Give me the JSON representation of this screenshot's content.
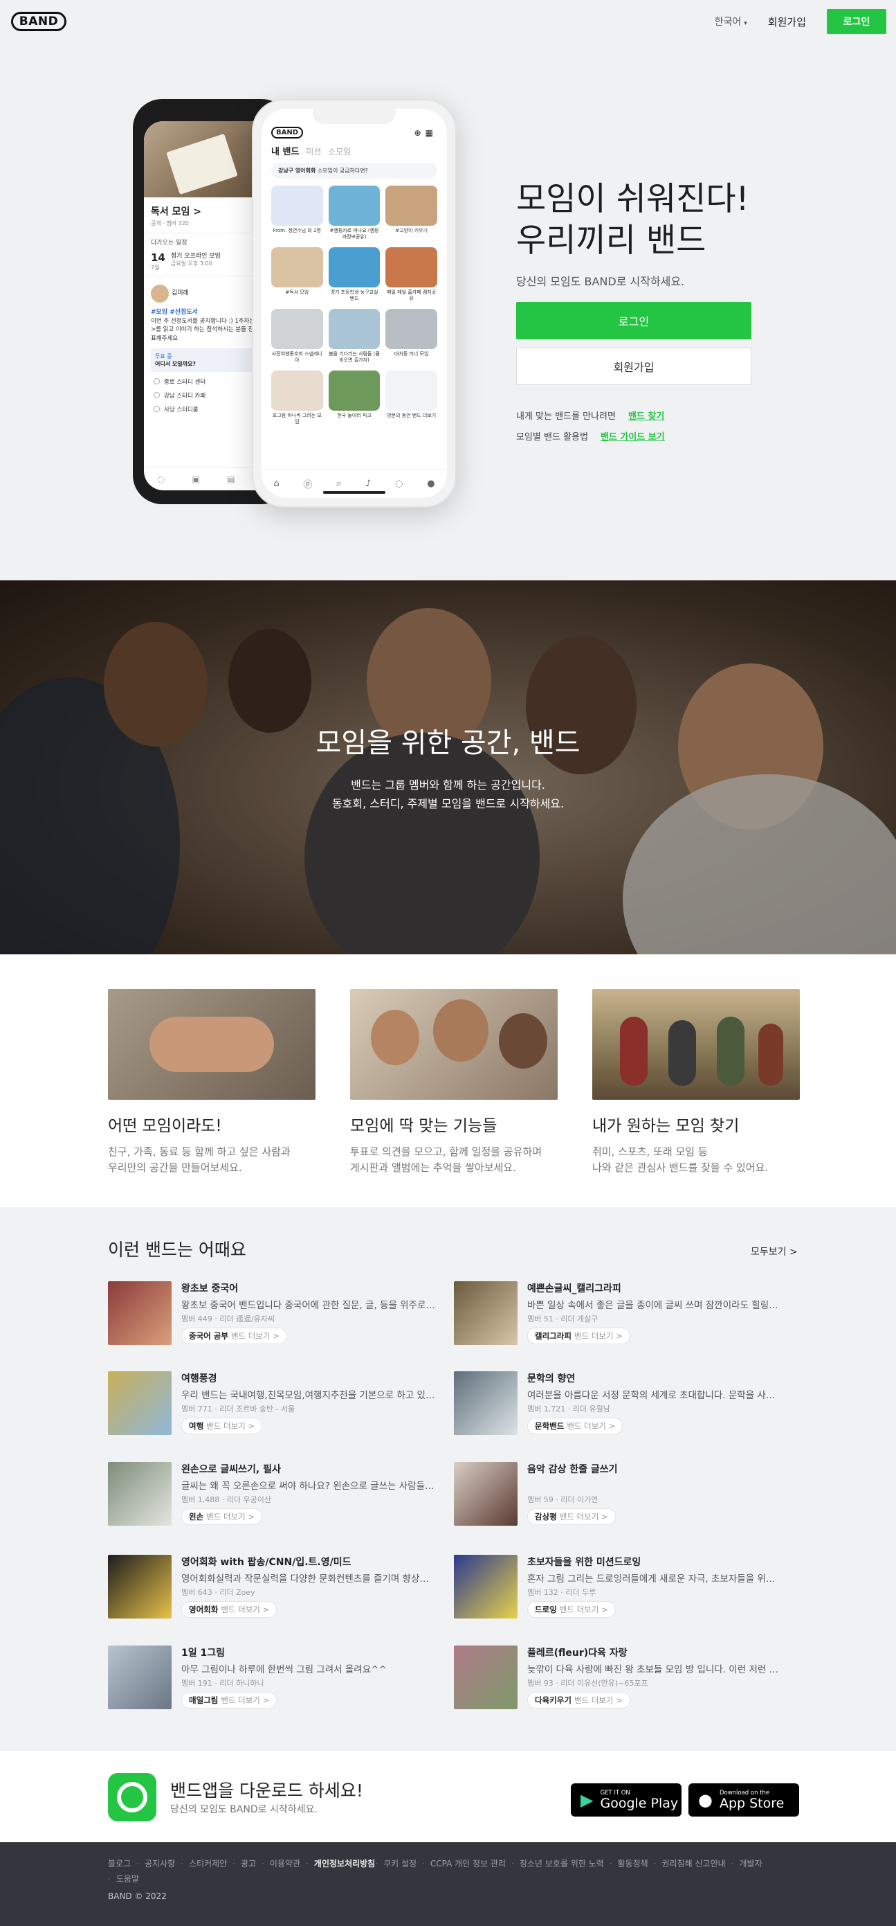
{
  "header": {
    "logo": "BAND",
    "language": "한국어",
    "signup": "회원가입",
    "login": "로그인"
  },
  "hero": {
    "title_line1": "모임이 쉬워진다!",
    "title_line2": "우리끼리 밴드",
    "subtitle": "당신의 모임도 BAND로 시작하세요.",
    "login_button": "로그인",
    "signup_button": "회원가입",
    "link1_text": "내게 맞는 밴드를 만나려면",
    "link1_label": "밴드 찾기",
    "link2_text": "모임별 밴드 활용법",
    "link2_label": "밴드 가이드 보기"
  },
  "phone_back": {
    "band_title": "독서 모임 >",
    "band_meta": "공개 · 멤버 320",
    "upcoming": "다가오는 일정",
    "date_day": "14",
    "date_month": "7월",
    "event_title": "정기 오프라인 모임",
    "event_time": "금요일 오후 3:00",
    "author": "김미래",
    "hashtags": "#모임 #선정도서",
    "post_text": "이번 주 선정도서를 공지합니다 :) 1주차는 <고래>를 읽고 이야기 하는 참석하시는 분들 장소를 투표해주세요",
    "vote_label": "투표 중",
    "vote_question": "어디서 모일까요?",
    "options": [
      "종로 스터디 센터",
      "강남 스터디 카페",
      "사당 스터디룸"
    ]
  },
  "phone_front": {
    "logo": "BAND",
    "tab_mine": "내 밴드",
    "tab_mission": "미션",
    "tab_small": "소모임",
    "notice_bold": "강남구 영어회화",
    "notice_text": "소모임이 궁금하다면?",
    "grid": [
      {
        "label": "From. 정연수님 외 2명",
        "color": "#dfe6f6"
      },
      {
        "label": "#캠핑카로 떠나요 (캠핑카정보공유)",
        "color": "#6fb3d9"
      },
      {
        "label": "#고양이 키우기",
        "color": "#c8a37e"
      },
      {
        "label": "#독서 모임",
        "color": "#d9c3a2"
      },
      {
        "label": "경기 초등학생 농구교실 밴드",
        "color": "#4a9fd1"
      },
      {
        "label": "매일 매일 홈카페 캠지공유",
        "color": "#c9784b"
      },
      {
        "label": "사진여행동호회 스냅레니아",
        "color": "#cfd3d6"
      },
      {
        "label": "봄을 기다리는 사람들 (물비오면 출가자)",
        "color": "#a9c4d4"
      },
      {
        "label": "대치동 러너 모임",
        "color": "#b9bec4"
      },
      {
        "label": "포그림 하나씩 그려는 모임",
        "color": "#e7dccd"
      },
      {
        "label": "한국 놀이터 피크",
        "color": "#6d9a5a"
      },
      {
        "label": "방문의 동안 밴드 더보기",
        "color": "#f2f3f5"
      }
    ]
  },
  "banner": {
    "title": "모임을 위한 공간, 밴드",
    "line1": "밴드는 그룹 멤버와 함께 하는 공간입니다.",
    "line2": "동호회, 스터디, 주제별 모임을 밴드로 시작하세요."
  },
  "features": [
    {
      "title": "어떤 모임이라도!",
      "line1": "친구, 가족, 동료 등 함께 하고 싶은 사람과",
      "line2": "우리만의 공간을 만들어보세요."
    },
    {
      "title": "모임에 딱 맞는 기능들",
      "line1": "투표로 의견을 모으고, 함께 일정을 공유하며",
      "line2": "게시판과 앨범에는 추억을 쌓아보세요."
    },
    {
      "title": "내가 원하는 모임 찾기",
      "line1": "취미, 스포츠, 또래 모임 등",
      "line2": "나와 같은 관심사 밴드를 찾을 수 있어요."
    }
  ],
  "recommended": {
    "title": "이런 밴드는 어때요",
    "see_all": "모두보기 >",
    "more_suffix": "밴드 더보기 >",
    "items": [
      {
        "name": "왕초보 중국어",
        "desc": "왕초보 중국어 밴드입니다 중국어에 관한 질문, 글, 등을 위주로 올려주세요",
        "meta": "멤버 449 · 리더 遥遥/유자씨",
        "tag": "중국어 공부",
        "c1": "#8c3b3b",
        "c2": "#d9a07a"
      },
      {
        "name": "예쁜손글씨_캘리그라피",
        "desc": "바쁜 일상 속에서 좋은 글을 종이에 글씨 쓰며 잠깐이라도 힐링하는 시간",
        "meta": "멤버 51 · 리더 개살구",
        "tag": "캘리그라피",
        "c1": "#6b5b3e",
        "c2": "#d6c7a8"
      },
      {
        "name": "여행풍경",
        "desc": "우리 밴드는 국내여행,친목모임,여행지추천을 기본으로 하고 있습니다",
        "meta": "멤버 771 · 리더 조르바 송탄 - 서울",
        "tag": "여행",
        "c1": "#c9b05a",
        "c2": "#8fb8d8"
      },
      {
        "name": "문학의 향연",
        "desc": "여러분을 아름다운 서정 문학의 세계로 초대합니다. 문학을 사랑하는 분들",
        "meta": "멤버 1,721 · 리더 유월남",
        "tag": "문학밴드",
        "c1": "#5f6f7a",
        "c2": "#dce3e6"
      },
      {
        "name": "왼손으로 글씨쓰기, 필사",
        "desc": "글씨는 왜 꼭 오른손으로 써야 하나요? 왼손으로 글쓰는 사람들의 모임",
        "meta": "멤버 1,488 · 리더 우공이산",
        "tag": "왼손",
        "c1": "#7e8c7a",
        "c2": "#e3e6e0"
      },
      {
        "name": "음악 감상 한줄 글쓰기",
        "desc": "",
        "meta": "멤버 59 · 리더 이가연",
        "tag": "감상평",
        "c1": "#d8cfc4",
        "c2": "#5b3a32"
      },
      {
        "name": "영어회화 with 팝송/CNN/입.트.영/미드",
        "desc": "영어회화실력과 작문실력을 다양한 문화컨텐츠를 즐기며 향상시켜요",
        "meta": "멤버 643 · 리더 Zoey",
        "tag": "영어회화",
        "c1": "#1d1d1d",
        "c2": "#e8c24a"
      },
      {
        "name": "초보자들을 위한 미션드로잉",
        "desc": "혼자 그림 그리는 드로잉러들에게 새로운 자극, 초보자들을 위한 미션",
        "meta": "멤버 132 · 리더 두루",
        "tag": "드로잉",
        "c1": "#2b3a8f",
        "c2": "#e8d24a"
      },
      {
        "name": "1일 1그림",
        "desc": "아무 그림이나 하루에 한번씩 그림 그려서 올려요^^",
        "meta": "멤버 191 · 리더 하니하니",
        "tag": "매일그림",
        "c1": "#b9c4d0",
        "c2": "#6a7684"
      },
      {
        "name": "플레르(fleur)다육 자랑",
        "desc": "늦깎이 다육 사랑에 빠진 왕 초보들 모임 방 입니다. 이런 저런 다육 이야기",
        "meta": "멤버 93 · 리더 이유선(만유)~65포프",
        "tag": "다육키우기",
        "c1": "#b07a8a",
        "c2": "#7d9a6a"
      }
    ]
  },
  "app": {
    "title": "밴드앱을 다운로드 하세요!",
    "subtitle": "당신의 모임도 BAND로 시작하세요.",
    "google_small": "GET IT ON",
    "google_big": "Google Play",
    "apple_small": "Download on the",
    "apple_big": "App Store"
  },
  "footer": {
    "links": [
      "블로그",
      "공지사항",
      "스티커제안",
      "광고",
      "이용약관",
      "개인정보처리방침",
      "쿠키 설정",
      "CCPA 개인 정보 관리",
      "청소년 보호를 위한 노력",
      "활동정책",
      "권리침해 신고안내",
      "개발자",
      "도움말"
    ],
    "copyright": "BAND © 2022"
  },
  "colors": {
    "brand_green": "#23c542",
    "footer_bg": "#33363d",
    "hero_bg": "#eff1f3"
  }
}
